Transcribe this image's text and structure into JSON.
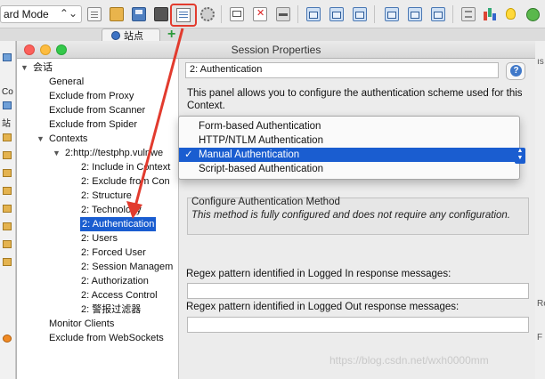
{
  "toolbar": {
    "mode_label": "ard Mode",
    "mode_chevron": "⌃⌄"
  },
  "sites_tab": {
    "label": "站点",
    "add": "+"
  },
  "left_edge": [
    "Co",
    "站"
  ],
  "right_edge": [
    "ıs",
    "Re",
    "F"
  ],
  "dialog": {
    "title": "Session Properties",
    "tree": [
      {
        "label": "会话",
        "twisty": "▼"
      },
      {
        "label": "General"
      },
      {
        "label": "Exclude from Proxy"
      },
      {
        "label": "Exclude from Scanner"
      },
      {
        "label": "Exclude from Spider"
      },
      {
        "label": "Contexts",
        "twisty": "▼"
      },
      {
        "label": "2:http://testphp.vulnwe",
        "twisty": "▼"
      },
      {
        "label": "2: Include in Context"
      },
      {
        "label": "2: Exclude from Con"
      },
      {
        "label": "2: Structure"
      },
      {
        "label": "2: Technology"
      },
      {
        "label": "2: Authentication"
      },
      {
        "label": "2: Users"
      },
      {
        "label": "2: Forced User"
      },
      {
        "label": "2: Session Managem"
      },
      {
        "label": "2: Authorization"
      },
      {
        "label": "2: Access Control"
      },
      {
        "label": "2: 警报过滤器"
      },
      {
        "label": "Monitor Clients"
      },
      {
        "label": "Exclude from WebSockets"
      }
    ],
    "panel": {
      "header": "2: Authentication",
      "help": "?",
      "description": "This panel allows you to configure the authentication scheme used for this Context.",
      "dropdown_options": [
        "Form-based Authentication",
        "HTTP/NTLM Authentication",
        "Manual Authentication",
        "Script-based Authentication"
      ],
      "dropdown_check": "✓",
      "selected_index": 2,
      "method_title": "Configure Authentication Method",
      "method_text": "This method is fully configured and does not require any configuration.",
      "logged_in_label": "Regex pattern identified in Logged In response messages:",
      "logged_in_value": "",
      "logged_out_label": "Regex pattern identified in Logged Out response messages:",
      "logged_out_value": ""
    }
  },
  "watermark": "https://blog.csdn.net/wxh0000mm",
  "colors": {
    "selection": "#1a5dd0",
    "annotation": "#e23b2e"
  }
}
